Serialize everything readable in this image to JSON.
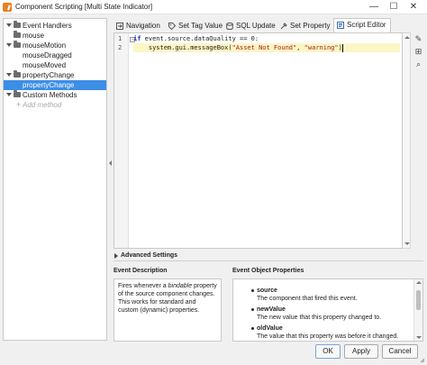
{
  "window": {
    "title": "Component Scripting [Multi State Indicator]",
    "minimize_glyph": "—",
    "maximize_glyph": "☐",
    "close_glyph": "✕"
  },
  "tree": {
    "items": [
      {
        "label": "Event Handlers",
        "level": 0,
        "kind": "folder-open"
      },
      {
        "label": "mouse",
        "level": 1,
        "kind": "folder-closed"
      },
      {
        "label": "mouseMotion",
        "level": 1,
        "kind": "folder-open"
      },
      {
        "label": "mouseDragged",
        "level": 2,
        "kind": "leaf"
      },
      {
        "label": "mouseMoved",
        "level": 2,
        "kind": "leaf"
      },
      {
        "label": "propertyChange",
        "level": 1,
        "kind": "folder-open"
      },
      {
        "label": "propertyChange",
        "level": 2,
        "kind": "leaf-selected"
      },
      {
        "label": "Custom Methods",
        "level": 0,
        "kind": "folder-open"
      },
      {
        "label": "Add method",
        "level": 1,
        "kind": "add"
      }
    ],
    "add_glyph": "+"
  },
  "tabs": [
    {
      "label": "Navigation",
      "icon": "navigation-icon",
      "active": false
    },
    {
      "label": "Set Tag Value",
      "icon": "tag-icon",
      "active": false
    },
    {
      "label": "SQL Update",
      "icon": "database-icon",
      "active": false
    },
    {
      "label": "Set Property",
      "icon": "property-icon",
      "active": false
    },
    {
      "label": "Script Editor",
      "icon": "script-icon",
      "active": true
    }
  ],
  "editor": {
    "line_numbers": [
      "1",
      "2"
    ],
    "fold_glyph": "−",
    "line1": {
      "keyword": "if",
      "code": " event.source.dataQuality == 0:"
    },
    "line2": {
      "indent": "    ",
      "call": "system.gui.messageBox(",
      "arg1": "\"Asset Not Found\"",
      "sep": ", ",
      "arg2": "\"warning\"",
      "close": ")"
    }
  },
  "side_tools": [
    "✎",
    "⊞",
    "⌕"
  ],
  "advanced_settings": {
    "label": "Advanced Settings"
  },
  "event_description": {
    "title": "Event Description",
    "text_before": "Fires whenever a ",
    "emphasis": "bindable",
    "text_after": " property of the source component changes. This works for standard and custom (dynamic) properties."
  },
  "event_props": {
    "title": "Event Object Properties",
    "items": [
      {
        "name": "source",
        "desc": "The component that fired this event."
      },
      {
        "name": "newValue",
        "desc": "The new value that this property changed to."
      },
      {
        "name": "oldValue",
        "desc": "The value that this property was before it changed."
      }
    ]
  },
  "buttons": {
    "ok": "OK",
    "apply": "Apply",
    "cancel": "Cancel"
  }
}
